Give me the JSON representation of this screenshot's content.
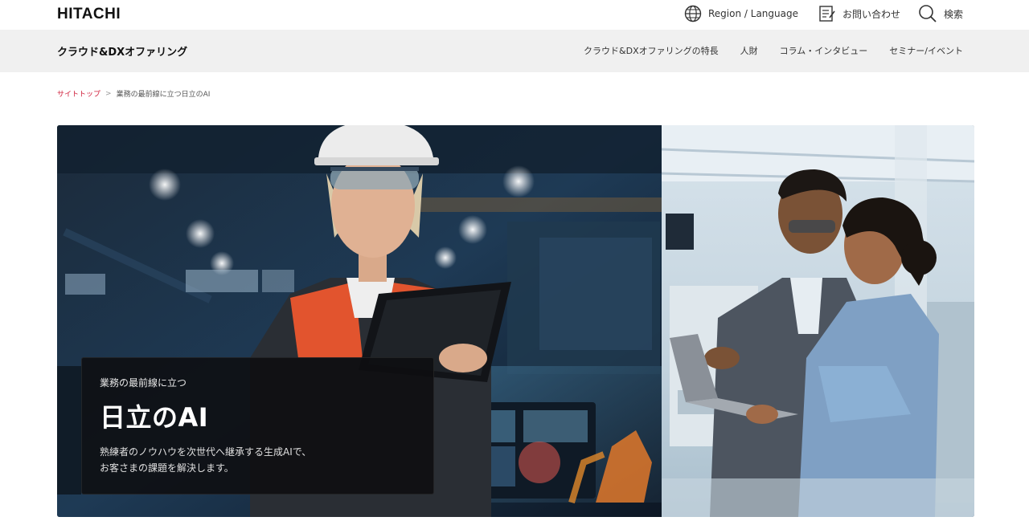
{
  "header": {
    "logo": "HITACHI",
    "region_label": "Region / Language",
    "contact_label": "お問い合わせ",
    "search_label": "検索"
  },
  "subnav": {
    "title": "クラウド&DXオファリング",
    "links": [
      "クラウド&DXオファリングの特長",
      "人財",
      "コラム・インタビュー",
      "セミナー/イベント"
    ]
  },
  "breadcrumb": {
    "home": "サイトトップ",
    "separator": ">",
    "current": "業務の最前線に立つ日立のAI"
  },
  "hero": {
    "subtitle": "業務の最前線に立つ",
    "title": "日立のAI",
    "description_line1": "熟練者のノウハウを次世代へ継承する生成AIで、",
    "description_line2": "お客さまの課題を解決します。"
  },
  "colors": {
    "accent": "#d0223e",
    "subnav_bg": "#f0f0f0"
  }
}
